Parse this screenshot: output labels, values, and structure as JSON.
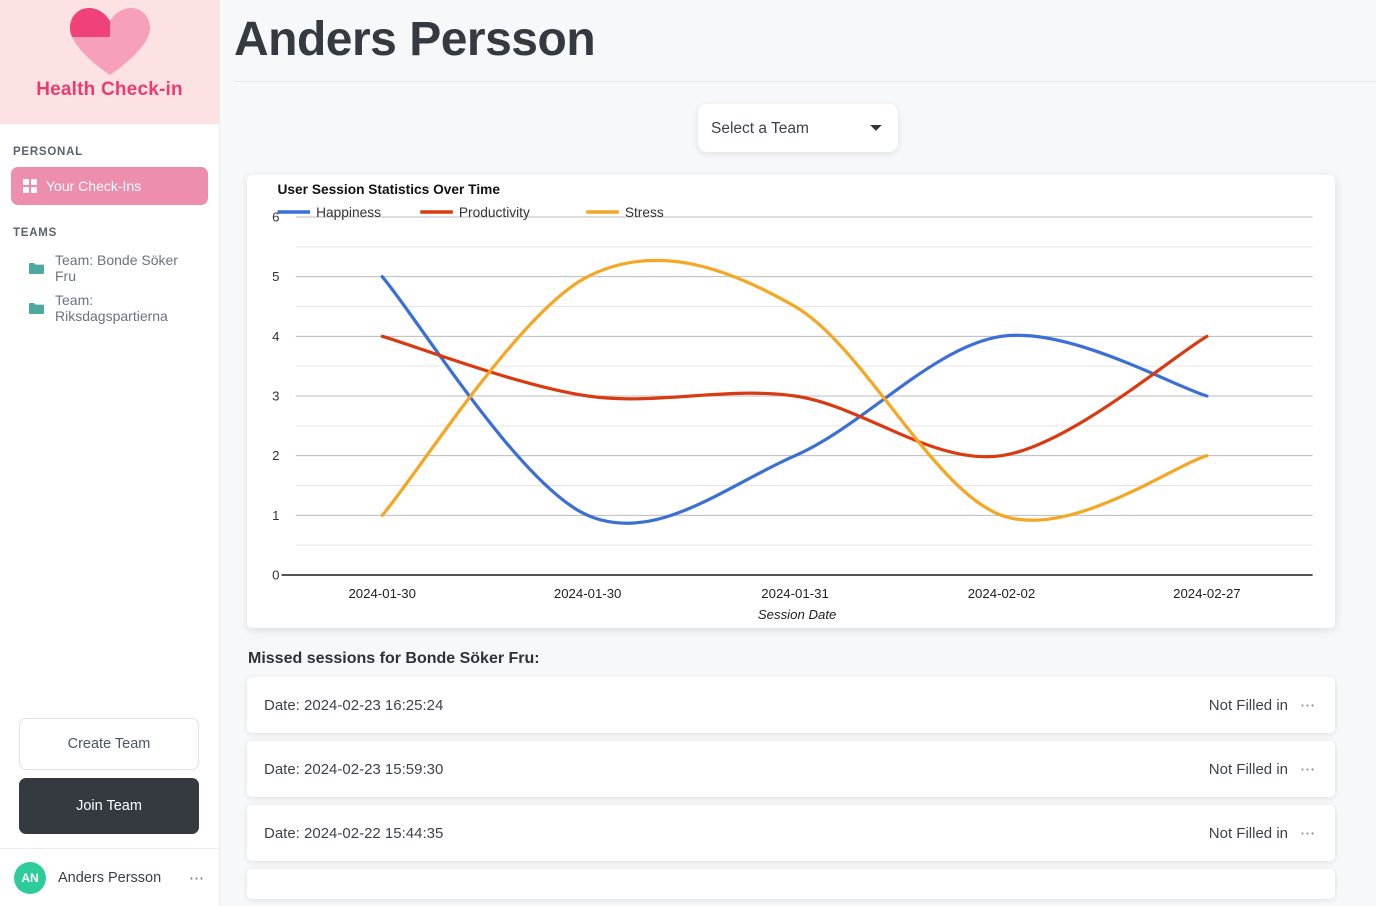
{
  "sidebar": {
    "brand": {
      "title": "Health Check-in",
      "logo_icon": "heart-icon"
    },
    "sections": [
      {
        "label": "PERSONAL"
      },
      {
        "label": "TEAMS"
      }
    ],
    "personal_items": [
      {
        "label": "Your Check-Ins",
        "icon": "grid-icon",
        "active": true
      }
    ],
    "team_items": [
      {
        "label": "Team: Bonde Söker Fru",
        "icon": "folder-icon"
      },
      {
        "label": "Team: Riksdagspartierna",
        "icon": "folder-icon"
      }
    ],
    "actions": {
      "create_team": "Create Team",
      "join_team": "Join Team"
    },
    "user": {
      "initials": "AN",
      "name": "Anders Persson",
      "menu_icon": "ellipsis-icon"
    }
  },
  "header": {
    "title": "Anders Persson"
  },
  "controls": {
    "team_select": {
      "selected": "Select a Team",
      "options": [
        "Select a Team",
        "Team: Bonde Söker Fru",
        "Team: Riksdagspartierna"
      ]
    }
  },
  "missed": {
    "heading": "Missed sessions for Bonde Söker Fru:",
    "rows": [
      {
        "date": "Date: 2024-02-23 16:25:24",
        "status": "Not Filled in",
        "menu": "⋯"
      },
      {
        "date": "Date: 2024-02-23 15:59:30",
        "status": "Not Filled in",
        "menu": "⋯"
      },
      {
        "date": "Date: 2024-02-22 15:44:35",
        "status": "Not Filled in",
        "menu": "⋯"
      }
    ]
  },
  "colors": {
    "brand_pink": "#ec3b6e",
    "brand_pink_bg": "#fde2e4",
    "active_item": "#ee8eaf",
    "folder_teal": "#4ca9a0",
    "avatar_green": "#2ecc9b",
    "dark_button": "#343a40",
    "happiness": "#3b6fd4",
    "productivity": "#d93a11",
    "stress": "#f5a623"
  },
  "chart_data": {
    "type": "line",
    "title": "User Session Statistics Over Time",
    "xlabel": "Session Date",
    "ylabel": "",
    "ylim": [
      0,
      6
    ],
    "yticks": [
      0,
      1,
      2,
      3,
      4,
      5,
      6
    ],
    "grid": true,
    "legend_position": "top-left",
    "categories": [
      "2024-01-30",
      "2024-01-30",
      "2024-01-31",
      "2024-02-02",
      "2024-02-27"
    ],
    "series": [
      {
        "name": "Happiness",
        "color": "#3b6fd4",
        "values": [
          5,
          1,
          2,
          4,
          3
        ]
      },
      {
        "name": "Productivity",
        "color": "#d93a11",
        "values": [
          4,
          3,
          3,
          2,
          4
        ]
      },
      {
        "name": "Stress",
        "color": "#f5a623",
        "values": [
          1,
          5,
          4.5,
          1,
          2
        ]
      }
    ]
  }
}
